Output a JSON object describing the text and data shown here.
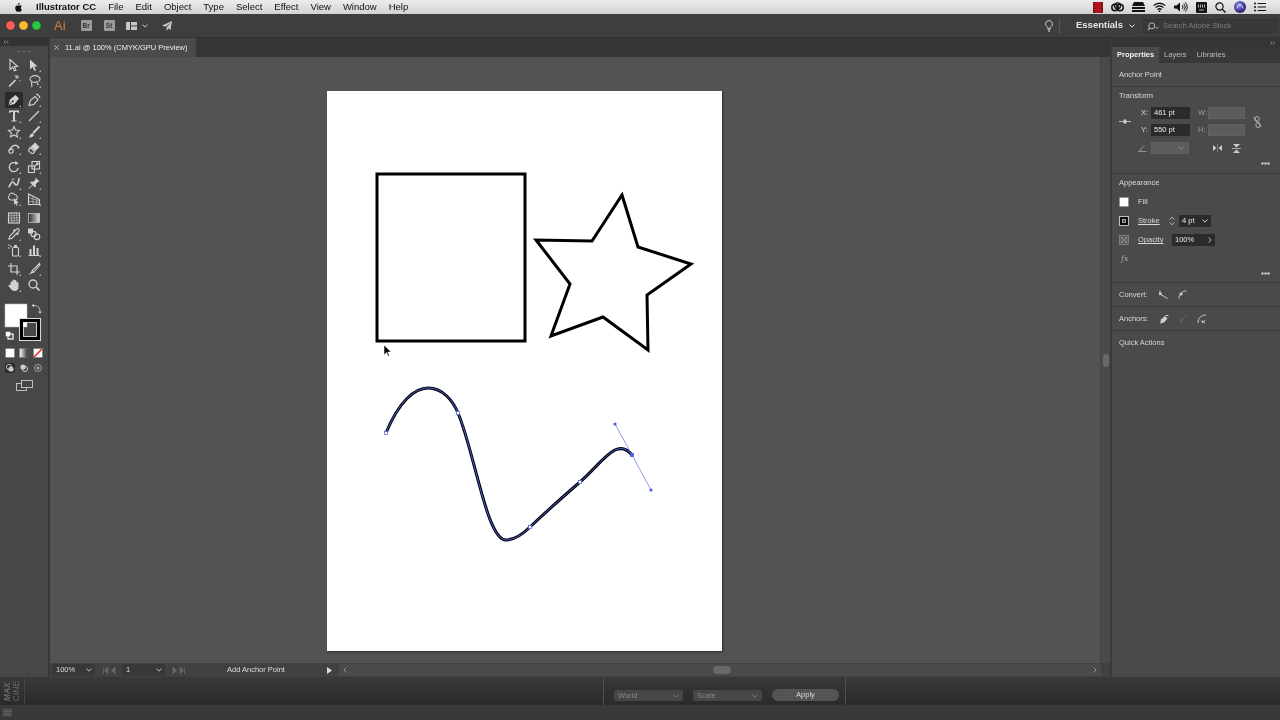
{
  "menu_bar": {
    "app_name": "Illustrator CC",
    "menus": [
      "File",
      "Edit",
      "Object",
      "Type",
      "Select",
      "Effect",
      "View",
      "Window",
      "Help"
    ]
  },
  "app_bar": {
    "logo": "Ai",
    "bridge_button": "Br",
    "stock_button": "St",
    "workspace": "Essentials",
    "search": {
      "placeholder": "Search Adobe Stock"
    }
  },
  "document_tabs": [
    {
      "label": "11.ai @ 100% (CMYK/GPU Preview)",
      "selected": true
    }
  ],
  "tools": [
    {
      "selected": false
    },
    {
      "selected": false
    },
    {
      "selected": false
    },
    {
      "selected": false
    },
    {
      "selected": true
    },
    {
      "selected": false
    },
    {
      "selected": false
    },
    {
      "selected": false
    },
    {
      "selected": false
    },
    {
      "selected": false
    },
    {
      "selected": false
    },
    {
      "selected": false
    },
    {
      "selected": false
    },
    {
      "selected": false
    },
    {
      "selected": false
    },
    {
      "selected": false
    },
    {
      "selected": false
    },
    {
      "selected": false
    },
    {
      "selected": false
    },
    {
      "selected": false
    },
    {
      "selected": false
    },
    {
      "selected": false
    },
    {
      "selected": false
    },
    {
      "selected": false
    },
    {
      "selected": false
    },
    {
      "selected": false
    },
    {
      "selected": false
    },
    {
      "selected": false
    }
  ],
  "artwork": [
    {
      "kind": "rectangle",
      "selected": false
    },
    {
      "kind": "star",
      "selected": false
    },
    {
      "kind": "curve",
      "selected": true
    }
  ],
  "properties_panel": {
    "tabs": [
      {
        "label": "Properties",
        "selected": true
      },
      {
        "label": "Layers",
        "selected": false
      },
      {
        "label": "Libraries",
        "selected": false
      }
    ],
    "selection": "Anchor Point",
    "transform": {
      "title": "Transform",
      "fields": [
        {
          "label": "X:",
          "value": "461 pt",
          "disabled": false
        },
        {
          "label": "W:",
          "disabled": true
        },
        {
          "label": "Y:",
          "value": "550 pt",
          "disabled": false
        },
        {
          "label": "H:",
          "disabled": true
        }
      ],
      "rotate_disabled": true
    },
    "appearance": {
      "title": "Appearance",
      "fill_label": "Fill",
      "stroke_label": "Stroke",
      "stroke_weight": "4 pt",
      "opacity_label": "Opacity",
      "opacity_value": "100%",
      "effects_button": "fx"
    },
    "convert_label": "Convert:",
    "anchors_label": "Anchors:",
    "quick_actions_title": "Quick Actions"
  },
  "status_bar": {
    "zoom": "100%",
    "artboard": "1",
    "current_tool": "Add Anchor Point"
  },
  "background_window": {
    "logo_lines": [
      "MAX",
      "CINE"
    ],
    "dropdowns": [
      "World",
      "Scale"
    ],
    "button": "Apply"
  }
}
